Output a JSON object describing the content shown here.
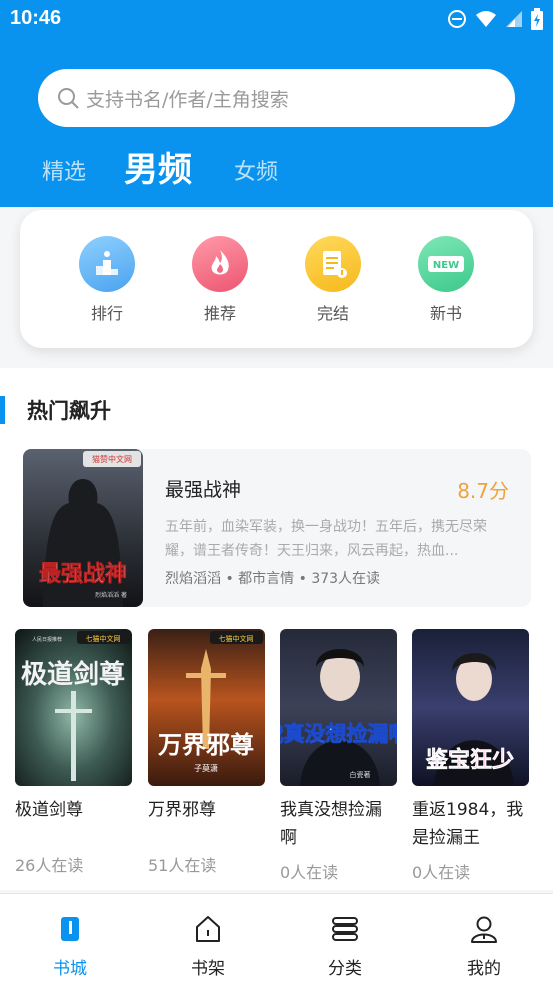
{
  "status": {
    "time": "10:46"
  },
  "search": {
    "placeholder": "支持书名/作者/主角搜索"
  },
  "tabs": [
    {
      "label": "精选"
    },
    {
      "label": "男频",
      "active": true
    },
    {
      "label": "女频"
    }
  ],
  "categories": [
    {
      "label": "排行",
      "icon": "ranking-icon",
      "color": "#5cb2f0"
    },
    {
      "label": "推荐",
      "icon": "fire-icon",
      "color": "#f26b85"
    },
    {
      "label": "完结",
      "icon": "document-icon",
      "color": "#f7c330"
    },
    {
      "label": "新书",
      "icon": "new-badge-icon",
      "color": "#52d39a",
      "badge": "NEW"
    }
  ],
  "section": {
    "title": "热门飙升"
  },
  "featured": {
    "title": "最强战神",
    "score": "8.7分",
    "description": "五年前，血染军装，换一身战功！五年后，携无尽荣耀，谱王者传奇！天王归来，风云再起，热血...",
    "meta": "烈焰滔滔 • 都市言情 • 373人在读",
    "cover": {
      "title": "最强战神",
      "badge": "猫赞中文网",
      "author": "烈焰滔滔 著"
    }
  },
  "books": [
    {
      "title": "极道剑尊",
      "readers": "26人在读",
      "cover_title": "极道剑尊",
      "cover_badge": "七猫中文网",
      "cover_top": "人民日报推荐"
    },
    {
      "title": "万界邪尊",
      "readers": "51人在读",
      "cover_title": "万界邪尊",
      "cover_badge": "七猫中文网",
      "cover_author": "子莫潇"
    },
    {
      "title": "我真没想捡漏啊",
      "readers": "0人在读",
      "cover_title": "我真没想捡漏啊",
      "cover_author": "白瓷著"
    },
    {
      "title": "重返1984，我是捡漏王",
      "readers": "0人在读",
      "cover_title": "鉴宝狂少"
    }
  ],
  "nav": [
    {
      "label": "书城",
      "icon": "bookstore-icon",
      "active": true
    },
    {
      "label": "书架",
      "icon": "bookshelf-icon"
    },
    {
      "label": "分类",
      "icon": "category-icon"
    },
    {
      "label": "我的",
      "icon": "profile-icon"
    }
  ],
  "colors": {
    "primary": "#0a93ee",
    "score": "#f0a23b"
  }
}
